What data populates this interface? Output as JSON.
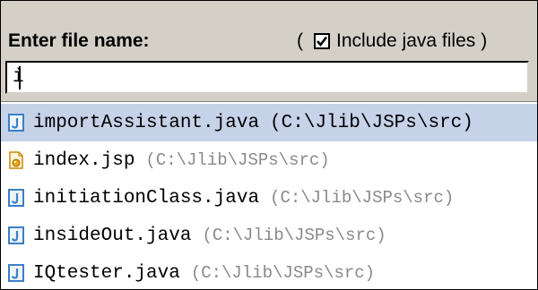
{
  "dialog": {
    "title": "Enter file name:",
    "paren_open": "(",
    "paren_close": ")",
    "include_java": {
      "label": "Include java files",
      "checked": true
    }
  },
  "search": {
    "value": "i",
    "placeholder": ""
  },
  "results": [
    {
      "name": "importAssistant.java",
      "path": "(C:\\Jlib\\JSPs\\src)",
      "icon": "java-file-icon",
      "selected": true
    },
    {
      "name": "index.jsp",
      "path": "(C:\\Jlib\\JSPs\\src)",
      "icon": "jsp-file-icon",
      "selected": false
    },
    {
      "name": "initiationClass.java",
      "path": "(C:\\Jlib\\JSPs\\src)",
      "icon": "java-file-icon",
      "selected": false
    },
    {
      "name": "insideOut.java",
      "path": "(C:\\Jlib\\JSPs\\src)",
      "icon": "java-file-icon",
      "selected": false
    },
    {
      "name": "IQtester.java",
      "path": "(C:\\Jlib\\JSPs\\src)",
      "icon": "java-file-icon",
      "selected": false
    }
  ],
  "colors": {
    "panel_bg": "#d4d0c8",
    "selection_bg": "#c6d2e8",
    "path_text": "#8a8a8a",
    "java_icon": "#3b7fc4",
    "jsp_icon": "#e8a317"
  }
}
